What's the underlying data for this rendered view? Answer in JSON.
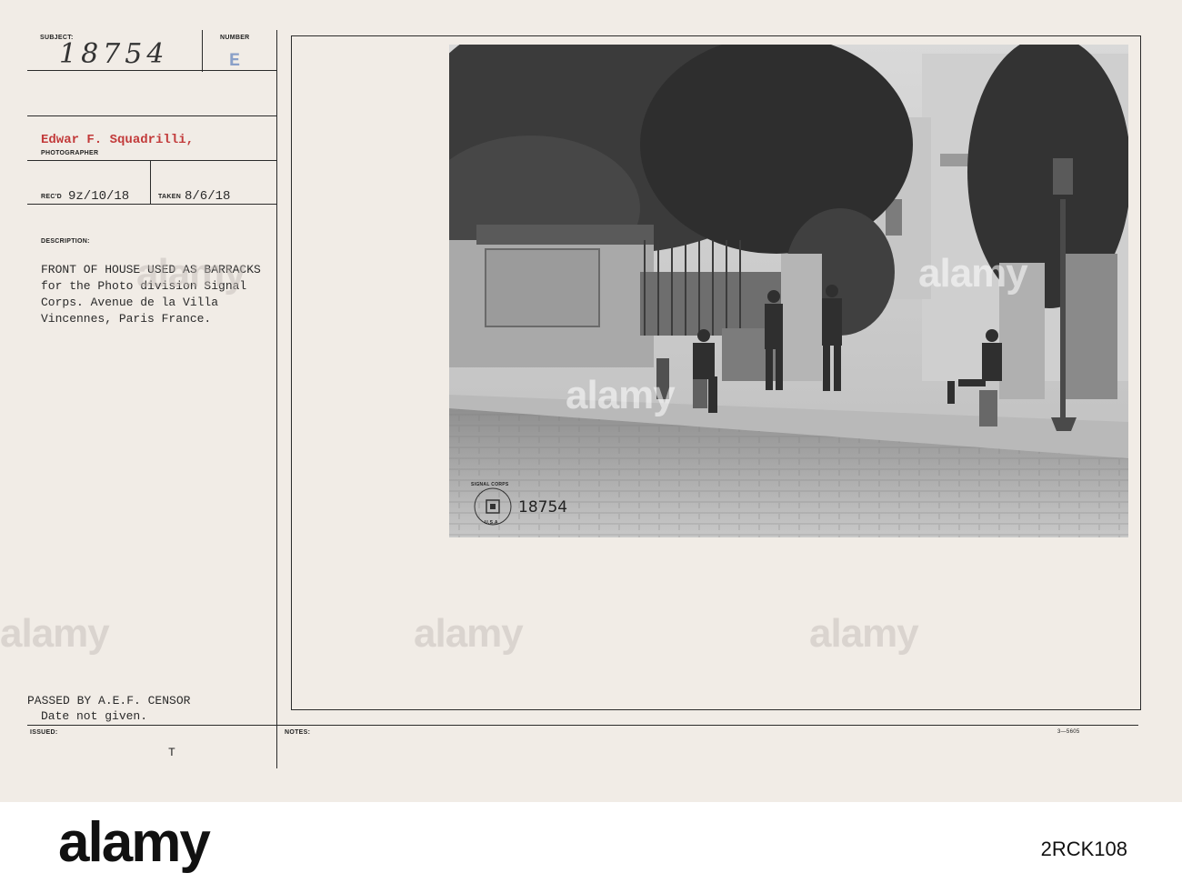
{
  "card": {
    "subject_label": "SUBJECT:",
    "subject_value": "18754",
    "number_label": "NUMBER",
    "number_value": "E",
    "photographer_name": "Edwar F. Squadrilli,",
    "photographer_label": "PHOTOGRAPHER",
    "recd_label": "REC'D",
    "recd_value": "9z/10/18",
    "taken_label": "TAKEN",
    "taken_value": "8/6/18",
    "description_label": "DESCRIPTION:",
    "description_text": "FRONT OF HOUSE USED AS BARRACKS\nfor the Photo division Signal\nCorps. Avenue de la Villa\nVincennes, Paris France.",
    "censor_line1": "PASSED BY A.E.F. CENSOR",
    "censor_line2": "Date not given.",
    "issued_label": "ISSUED:",
    "issued_value": "T",
    "notes_label": "NOTES:",
    "form_code": "3—5605"
  },
  "photo": {
    "stamp_top": "SIGNAL CORPS",
    "stamp_bottom": "U.S.A.",
    "negative_number": "18754"
  },
  "watermark": {
    "text": "alamy"
  },
  "footer": {
    "logo": "alamy",
    "image_id": "2RCK108"
  },
  "colors": {
    "card_bg": "#f1ece6",
    "photographer_red": "#c23a3a",
    "number_stamp_blue": "#8aa0c8"
  }
}
